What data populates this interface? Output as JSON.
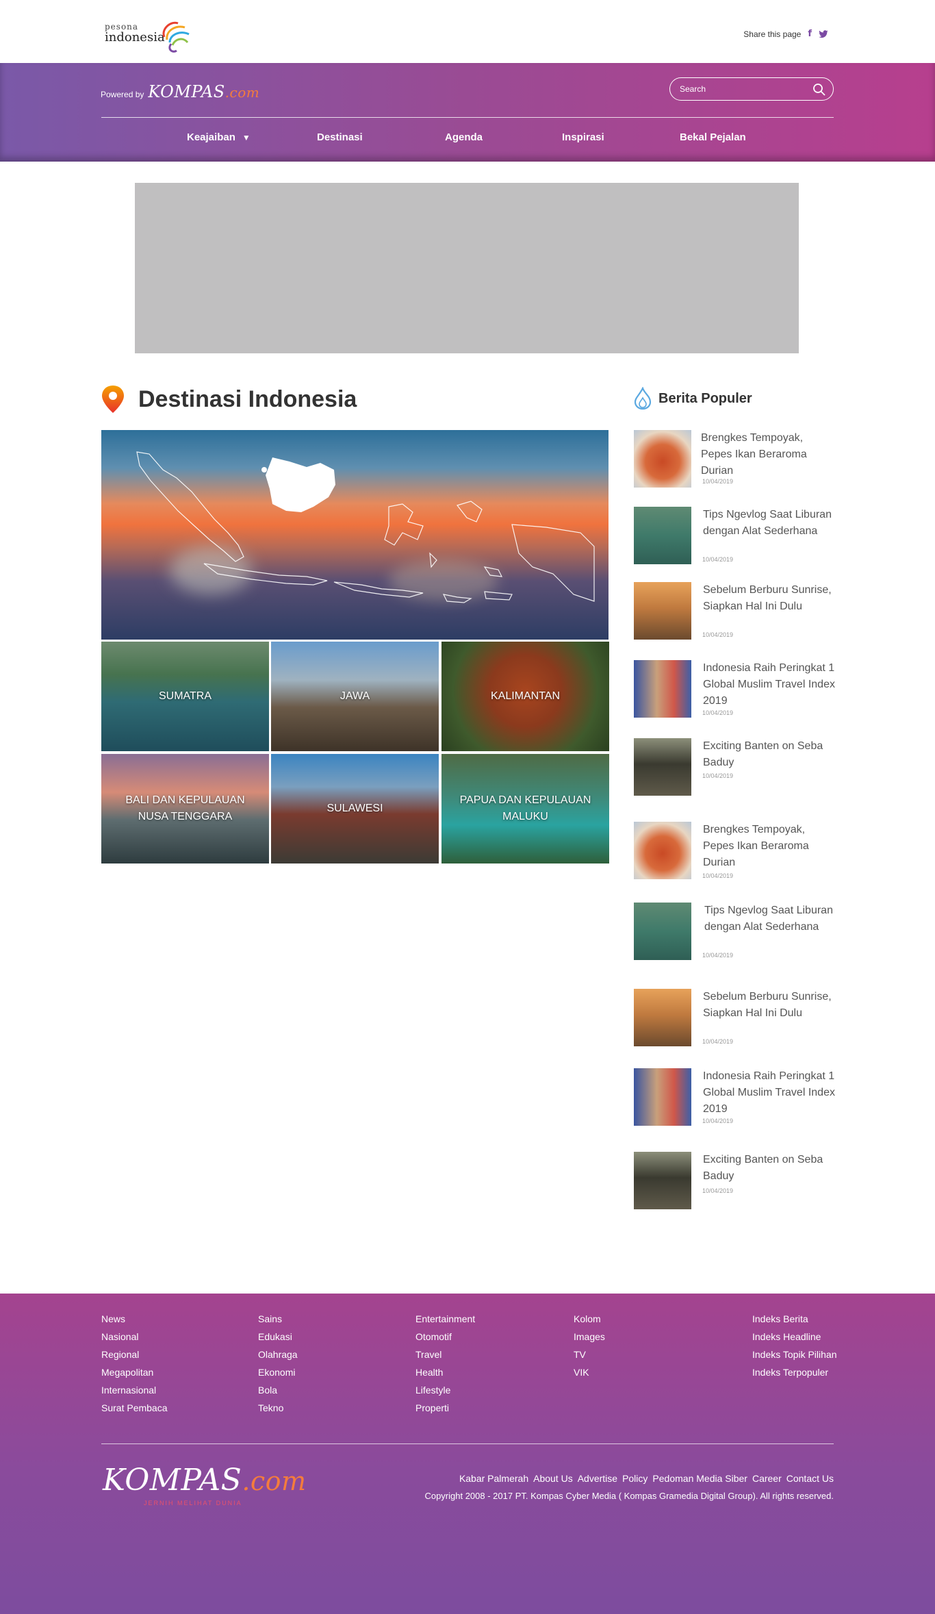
{
  "topbar": {
    "logo_small": "pesona",
    "logo_big": "indonesia",
    "share_label": "Share this page",
    "facebook_glyph": "f",
    "twitter_glyph": "🐦"
  },
  "header": {
    "powered_label": "Powered by",
    "kompas_main": "KOMPAS",
    "kompas_suffix": ".com",
    "search_placeholder": "Search",
    "nav": [
      {
        "label": "Keajaiban",
        "caret": "▼"
      },
      {
        "label": "Destinasi"
      },
      {
        "label": "Agenda"
      },
      {
        "label": "Inspirasi"
      },
      {
        "label": "Bekal Pejalan"
      }
    ]
  },
  "destinasi": {
    "title": "Destinasi Indonesia",
    "tiles": [
      {
        "label": "SUMATRA"
      },
      {
        "label": "JAWA"
      },
      {
        "label": "KALIMANTAN"
      },
      {
        "label": "BALI DAN KEPULAUAN NUSA TENGGARA"
      },
      {
        "label": "SULAWESI"
      },
      {
        "label": "PAPUA DAN KEPULAUAN MALUKU"
      }
    ]
  },
  "populer": {
    "title": "Berita Populer",
    "items": [
      {
        "title": "Brengkes Tempoyak, Pepes Ikan Beraroma Durian",
        "date": "10/04/2019",
        "thumb": "food"
      },
      {
        "title": "Tips Ngevlog Saat Liburan dengan Alat Sederhana",
        "date": "10/04/2019",
        "thumb": "swim"
      },
      {
        "title": "Sebelum Berburu Sunrise, Siapkan Hal Ini Dulu",
        "date": "10/04/2019",
        "thumb": "sunrise"
      },
      {
        "title": "Indonesia Raih Peringkat 1 Global Muslim Travel Index 2019",
        "date": "10/04/2019",
        "thumb": "muslim"
      },
      {
        "title": "Exciting Banten on Seba Baduy",
        "date": "10/04/2019",
        "thumb": "banten"
      },
      {
        "title": "Brengkes Tempoyak, Pepes Ikan Beraroma Durian",
        "date": "10/04/2019",
        "thumb": "food"
      },
      {
        "title": "Tips Ngevlog Saat Liburan dengan Alat Sederhana",
        "date": "10/04/2019",
        "thumb": "swim"
      },
      {
        "title": "Sebelum Berburu Sunrise, Siapkan Hal Ini Dulu",
        "date": "10/04/2019",
        "thumb": "sunrise"
      },
      {
        "title": "Indonesia Raih Peringkat 1 Global Muslim Travel Index 2019",
        "date": "10/04/2019",
        "thumb": "muslim"
      },
      {
        "title": "Exciting Banten on Seba Baduy",
        "date": "10/04/2019",
        "thumb": "banten"
      }
    ]
  },
  "footer": {
    "columns": [
      [
        "News",
        "Nasional",
        "Regional",
        "Megapolitan",
        "Internasional",
        "Surat Pembaca"
      ],
      [
        "Sains",
        "Edukasi",
        "Olahraga",
        "Ekonomi",
        "Bola",
        "Tekno"
      ],
      [
        "Entertainment",
        "Otomotif",
        "Travel",
        "Health",
        "Lifestyle",
        "Properti"
      ],
      [
        "Kolom",
        "Images",
        "TV",
        "VIK"
      ],
      [
        "Indeks Berita",
        "Indeks Headline",
        "Indeks Topik Pilihan",
        "Indeks Terpopuler"
      ]
    ],
    "logo_main": "KOMPAS",
    "logo_suffix": ".com",
    "tagline": "JERNIH MELIHAT DUNIA",
    "links": [
      "Kabar Palmerah",
      "About Us",
      "Advertise",
      "Policy",
      "Pedoman Media Siber",
      "Career",
      "Contact Us"
    ],
    "copyright": "Copyright 2008 - 2017 PT. Kompas Cyber Media ( Kompas Gramedia Digital Group). All rights reserved."
  },
  "colors": {
    "header_start": "#7a59a8",
    "header_end": "#b73f8e",
    "accent_orange": "#f47c3c",
    "footer": "#8a4b9c"
  }
}
